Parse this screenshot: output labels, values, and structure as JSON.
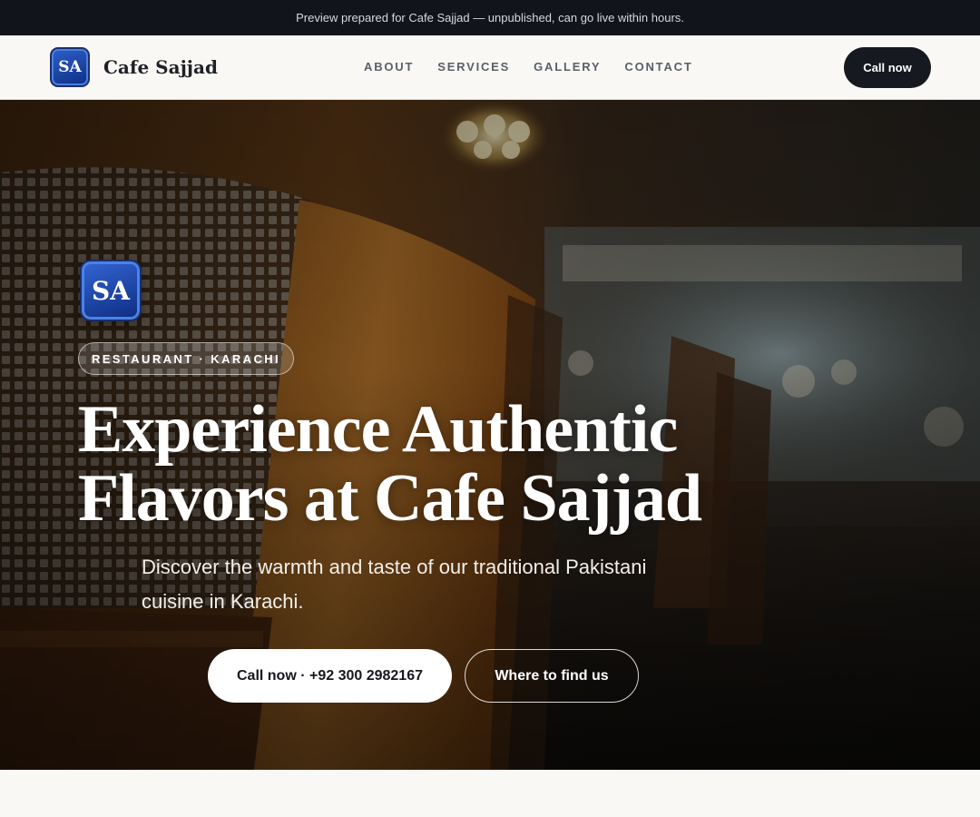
{
  "preview_bar": {
    "text": "Preview prepared for Cafe Sajjad — unpublished, can go live within hours."
  },
  "header": {
    "logo_text": "SA",
    "brand_name": "Cafe Sajjad",
    "nav": [
      "ABOUT",
      "SERVICES",
      "GALLERY",
      "CONTACT"
    ],
    "call_label": "Call now"
  },
  "hero": {
    "logo_text": "SA",
    "tag": "RESTAURANT · KARACHI",
    "title_line1": "Experience Authentic",
    "title_line2": "Flavors at Cafe Sajjad",
    "subtitle": "Discover the warmth and taste of our traditional Pakistani cuisine in Karachi.",
    "primary_cta": "Call now · +92 300 2982167",
    "secondary_cta": "Where to find us"
  },
  "colors": {
    "accent_dark": "#161920",
    "logo_blue": "#1f4fb3",
    "page_bg": "#f9f8f5"
  }
}
